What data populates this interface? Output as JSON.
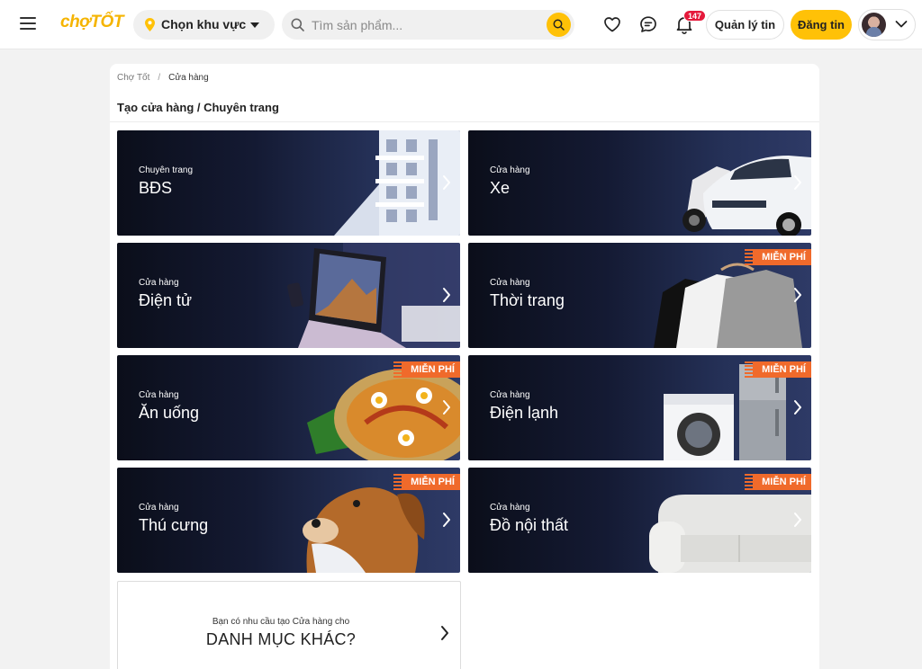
{
  "header": {
    "logo": "chợTỐT",
    "region_label": "Chọn khu vực",
    "search_placeholder": "Tìm sản phẩm...",
    "notification_count": "147",
    "manage_label": "Quản lý tin",
    "post_label": "Đăng tin"
  },
  "breadcrumb": {
    "home": "Chợ Tốt",
    "separator": "/",
    "current": "Cửa hàng"
  },
  "page_title": "Tạo cửa hàng / Chuyên trang",
  "free_badge": "MIỄN PHÍ",
  "tiles": [
    {
      "sub": "Chuyên trang",
      "name": "BĐS",
      "free": false,
      "art": "building"
    },
    {
      "sub": "Cửa hàng",
      "name": "Xe",
      "free": false,
      "art": "car-motorbike"
    },
    {
      "sub": "Cửa hàng",
      "name": "Điện tử",
      "free": false,
      "art": "laptop-phone"
    },
    {
      "sub": "Cửa hàng",
      "name": "Thời trang",
      "free": true,
      "art": "clothes"
    },
    {
      "sub": "Cửa hàng",
      "name": "Ăn uống",
      "free": true,
      "art": "food-plate"
    },
    {
      "sub": "Cửa hàng",
      "name": "Điện lạnh",
      "free": true,
      "art": "washer-fridge"
    },
    {
      "sub": "Cửa hàng",
      "name": "Thú cưng",
      "free": true,
      "art": "dog"
    },
    {
      "sub": "Cửa hàng",
      "name": "Đồ nội thất",
      "free": true,
      "art": "sofa"
    }
  ],
  "other_category": {
    "question": "Bạn có nhu cầu tạo Cửa hàng cho",
    "label": "DANH MỤC KHÁC?"
  },
  "colors": {
    "brand_yellow": "#ffc107",
    "free_orange": "#f06a2b",
    "badge_red": "#e5193b"
  }
}
